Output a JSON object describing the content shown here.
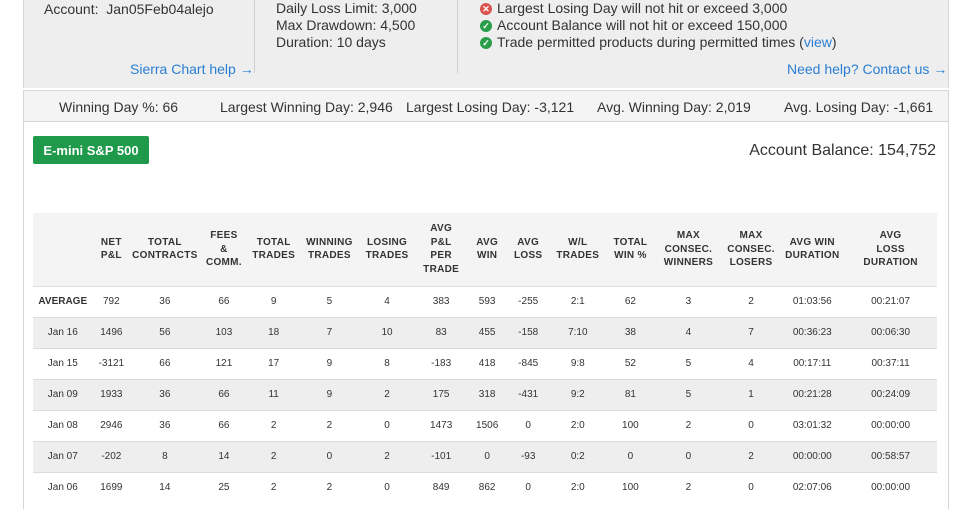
{
  "account": {
    "label": "Account:",
    "value": "Jan05Feb04alejo"
  },
  "limits": {
    "daily_loss": "Daily Loss Limit: 3,000",
    "max_drawdown": "Max Drawdown: 4,500",
    "duration": "Duration: 10 days"
  },
  "checks": [
    {
      "status": "fail",
      "text": "Largest Losing Day will not hit or exceed 3,000"
    },
    {
      "status": "pass",
      "text": "Account Balance will not hit or exceed 150,000"
    },
    {
      "status": "pass",
      "text": "Trade permitted products during permitted times (",
      "link": "view",
      "suffix": ")"
    }
  ],
  "links": {
    "sierra_help": "Sierra Chart help →",
    "need_help": "Need help? Contact us →"
  },
  "stats": {
    "winning_day_pct": "Winning Day %: 66",
    "largest_winning_day": "Largest Winning Day: 2,946",
    "largest_losing_day": "Largest Losing Day: -3,121",
    "avg_winning_day": "Avg. Winning Day: 2,019",
    "avg_losing_day": "Avg. Losing Day: -1,661"
  },
  "product": {
    "label": "E-mini S&P 500"
  },
  "balance": {
    "text": "Account Balance: 154,752"
  },
  "table": {
    "headers": [
      [
        ""
      ],
      [
        "NET",
        "P&L"
      ],
      [
        "TOTAL",
        "CONTRACTS"
      ],
      [
        "FEES",
        "&",
        "COMM."
      ],
      [
        "TOTAL",
        "TRADES"
      ],
      [
        "WINNING",
        "TRADES"
      ],
      [
        "LOSING",
        "TRADES"
      ],
      [
        "AVG",
        "P&L",
        "PER",
        "TRADE"
      ],
      [
        "AVG",
        "WIN"
      ],
      [
        "AVG",
        "LOSS"
      ],
      [
        "W/L",
        "TRADES"
      ],
      [
        "TOTAL",
        "WIN %"
      ],
      [
        "MAX",
        "CONSEC.",
        "WINNERS"
      ],
      [
        "MAX",
        "CONSEC.",
        "LOSERS"
      ],
      [
        "AVG WIN",
        "DURATION"
      ],
      [
        "AVG",
        "LOSS",
        "DURATION"
      ]
    ],
    "rows": [
      [
        "AVERAGE",
        "792",
        "36",
        "66",
        "9",
        "5",
        "4",
        "383",
        "593",
        "-255",
        "2:1",
        "62",
        "3",
        "2",
        "01:03:56",
        "00:21:07"
      ],
      [
        "Jan 16",
        "1496",
        "56",
        "103",
        "18",
        "7",
        "10",
        "83",
        "455",
        "-158",
        "7:10",
        "38",
        "4",
        "7",
        "00:36:23",
        "00:06:30"
      ],
      [
        "Jan 15",
        "-3121",
        "66",
        "121",
        "17",
        "9",
        "8",
        "-183",
        "418",
        "-845",
        "9:8",
        "52",
        "5",
        "4",
        "00:17:11",
        "00:37:11"
      ],
      [
        "Jan 09",
        "1933",
        "36",
        "66",
        "11",
        "9",
        "2",
        "175",
        "318",
        "-431",
        "9:2",
        "81",
        "5",
        "1",
        "00:21:28",
        "00:24:09"
      ],
      [
        "Jan 08",
        "2946",
        "36",
        "66",
        "2",
        "2",
        "0",
        "1473",
        "1506",
        "0",
        "2:0",
        "100",
        "2",
        "0",
        "03:01:32",
        "00:00:00"
      ],
      [
        "Jan 07",
        "-202",
        "8",
        "14",
        "2",
        "0",
        "2",
        "-101",
        "0",
        "-93",
        "0:2",
        "0",
        "0",
        "2",
        "00:00:00",
        "00:58:57"
      ],
      [
        "Jan 06",
        "1699",
        "14",
        "25",
        "2",
        "2",
        "0",
        "849",
        "862",
        "0",
        "2:0",
        "100",
        "2",
        "0",
        "02:07:06",
        "00:00:00"
      ]
    ]
  }
}
